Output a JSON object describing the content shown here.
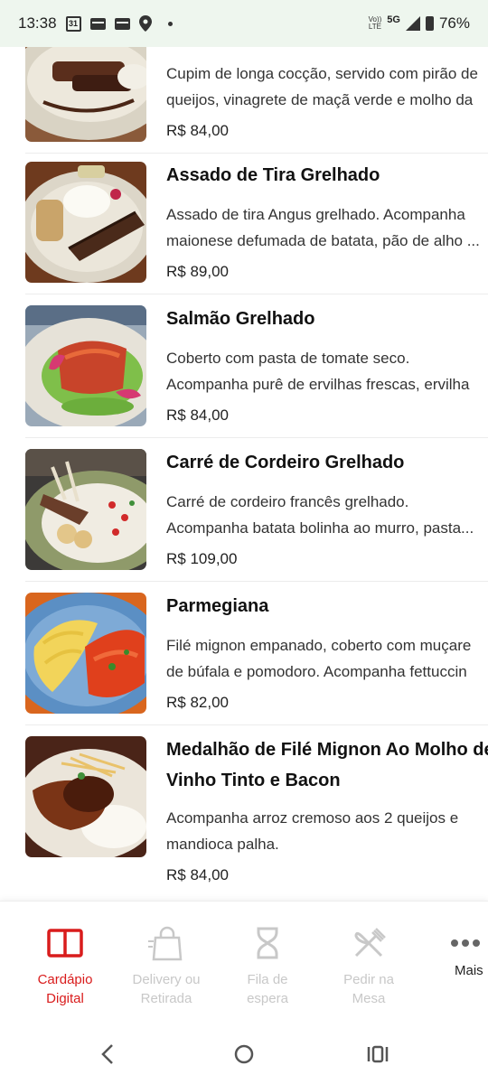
{
  "status_bar": {
    "time": "13:38",
    "calendar_day": "31",
    "volte_top": "Vo))",
    "volte_bottom": "LTE",
    "network": "5G",
    "battery": "76%"
  },
  "menu": {
    "items": [
      {
        "title": "",
        "desc_lines": [
          "Cupim de longa cocção, servido com pirão de",
          "queijos, vinagrete de maçã verde e molho da"
        ],
        "price": "R$ 84,00"
      },
      {
        "title": "Assado de Tira Grelhado",
        "desc_lines": [
          "Assado de tira Angus grelhado. Acompanha",
          "maionese defumada de batata, pão de alho ..."
        ],
        "price": "R$ 89,00"
      },
      {
        "title": "Salmão Grelhado",
        "desc_lines": [
          "Coberto com pasta de tomate seco.",
          "Acompanha purê de ervilhas frescas, ervilha"
        ],
        "price": "R$ 84,00"
      },
      {
        "title": "Carré de Cordeiro Grelhado",
        "desc_lines": [
          "Carré de cordeiro francês grelhado.",
          "Acompanha batata bolinha ao murro, pasta..."
        ],
        "price": "R$ 109,00"
      },
      {
        "title": "Parmegiana",
        "desc_lines": [
          "Filé mignon empanado, coberto com muçare",
          "de búfala e pomodoro. Acompanha fettuccin"
        ],
        "price": "R$ 82,00"
      },
      {
        "title_lines": [
          "Medalhão de Filé Mignon Ao Molho de",
          "Vinho Tinto e Bacon"
        ],
        "desc_lines": [
          "Acompanha arroz cremoso aos 2 queijos e",
          "mandioca palha."
        ],
        "price": "R$ 84,00"
      }
    ]
  },
  "bottom_nav": {
    "items": [
      {
        "label_1": "Cardápio",
        "label_2": "Digital",
        "icon": "book-icon",
        "state": "active"
      },
      {
        "label_1": "Delivery ou",
        "label_2": "Retirada",
        "icon": "shopping-bag-icon",
        "state": "inactive"
      },
      {
        "label_1": "Fila de",
        "label_2": "espera",
        "icon": "hourglass-icon",
        "state": "inactive"
      },
      {
        "label_1": "Pedir na",
        "label_2": "Mesa",
        "icon": "cutlery-icon",
        "state": "inactive"
      },
      {
        "label_1": "Mais",
        "label_2": "",
        "icon": "more-dots-icon",
        "state": "normal"
      }
    ]
  },
  "colors": {
    "accent": "#d91c1c",
    "inactive": "#c8c8c8",
    "status_bar_bg": "#eef6ee"
  }
}
